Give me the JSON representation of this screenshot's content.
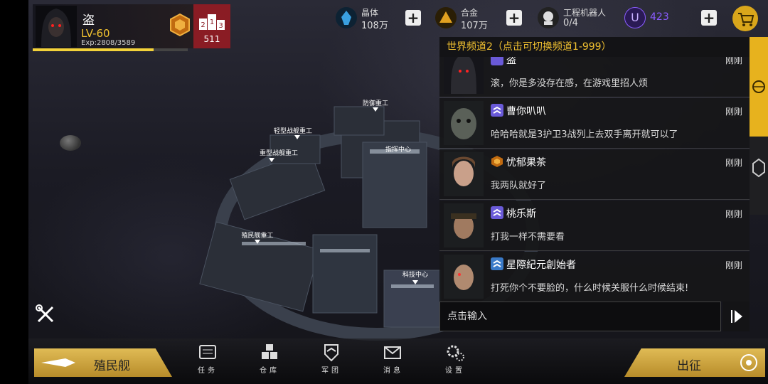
{
  "player": {
    "name": "盗",
    "level": "LV-60",
    "exp": "Exp:2808/3589",
    "exp_fraction": 0.78,
    "rank_digits": "213",
    "rank_value": "511"
  },
  "resources": [
    {
      "label": "晶体",
      "value": "108万",
      "icon": "crystal-icon",
      "color": "#3aa0e0"
    },
    {
      "label": "合金",
      "value": "107万",
      "icon": "alloy-icon",
      "color": "#e0a020"
    },
    {
      "label": "工程机器人",
      "value": "0/4",
      "icon": "robot-icon",
      "color": "#dddddd"
    },
    {
      "label": "",
      "value": "423",
      "icon": "u-currency-icon",
      "color": "#8a5cff"
    }
  ],
  "map_labels": [
    "防御重工",
    "轻型战舰重工",
    "重型战舰重工",
    "指挥中心",
    "殖民舰重工",
    "科技中心"
  ],
  "chat": {
    "channel": "世界频道2（点击可切换频道1-999）",
    "messages": [
      {
        "user": "盗",
        "time": "刚刚",
        "text": "滚，你是多没存在感，在游戏里招人烦",
        "rank_icon": "rank-chevron-icon"
      },
      {
        "user": "曹你叭叭",
        "time": "刚刚",
        "text": "哈哈哈就是3护卫3战列上去双手离开就可以了",
        "rank_icon": "rank-chevron-icon"
      },
      {
        "user": "忧郁果茶",
        "time": "刚刚",
        "text": "我两队就好了",
        "rank_icon": "rank-medal-icon"
      },
      {
        "user": "桃乐斯",
        "time": "刚刚",
        "text": "打我一样不需要看",
        "rank_icon": "rank-chevron-icon"
      },
      {
        "user": "星際紀元創始者",
        "time": "刚刚",
        "text": "打死你个不要脸的，什么时候关服什么时候结束!",
        "rank_icon": "rank-chevron-icon"
      }
    ],
    "input_placeholder": "点击输入"
  },
  "bottom": {
    "colony_ship": "殖民舰",
    "deploy": "出征",
    "nav": [
      {
        "label": "任务",
        "icon": "tasks-icon"
      },
      {
        "label": "仓库",
        "icon": "warehouse-icon"
      },
      {
        "label": "军团",
        "icon": "legion-icon"
      },
      {
        "label": "消息",
        "icon": "messages-icon"
      },
      {
        "label": "设置",
        "icon": "settings-icon"
      }
    ]
  }
}
